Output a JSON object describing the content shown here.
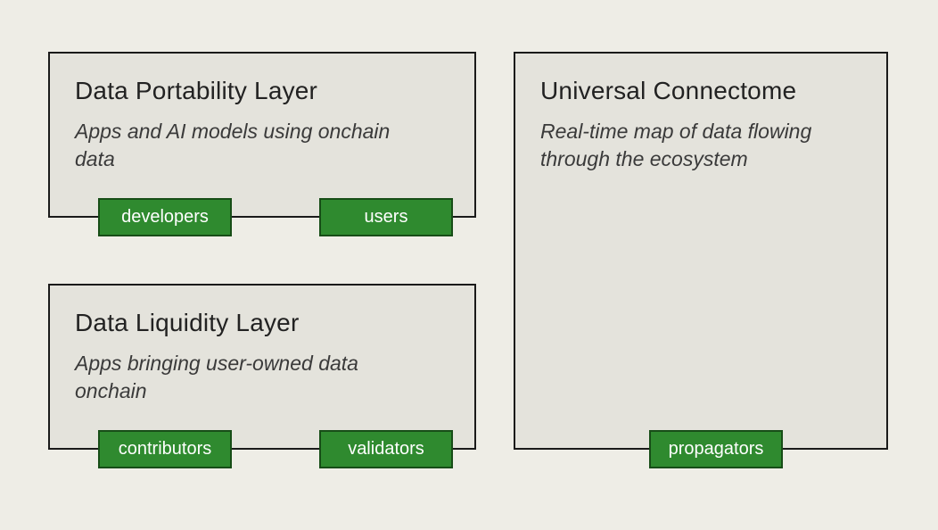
{
  "boxes": {
    "portability": {
      "title": "Data Portability Layer",
      "desc": "Apps and AI models using onchain data"
    },
    "liquidity": {
      "title": "Data Liquidity Layer",
      "desc": "Apps bringing user-owned data onchain"
    },
    "connectome": {
      "title": "Universal Connectome",
      "desc": "Real-time map of data flowing through the ecosystem"
    }
  },
  "tags": {
    "developers": "developers",
    "users": "users",
    "contributors": "contributors",
    "validators": "validators",
    "propagators": "propagators"
  },
  "colors": {
    "bg": "#eeede6",
    "boxFill": "#e4e3dc",
    "boxBorder": "#1a1a1a",
    "tagFill": "#2f8a2f",
    "tagBorder": "#174d17",
    "tagText": "#ffffff"
  }
}
